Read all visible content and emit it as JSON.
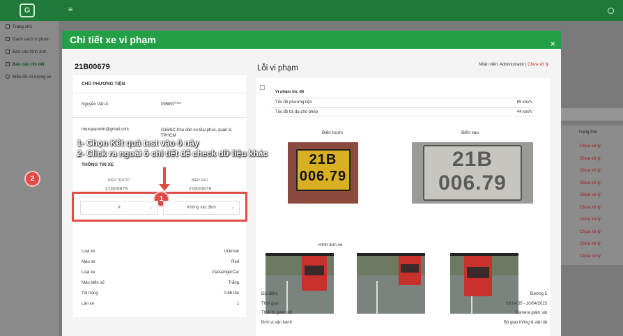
{
  "sidebar": {
    "items": [
      {
        "label": "Trang chủ"
      },
      {
        "label": "Danh sách vi phạm"
      },
      {
        "label": "Báo cáo hình ảnh"
      },
      {
        "label": "Báo cáo chi tiết"
      },
      {
        "label": "Biểu đồ số lượng xe"
      }
    ],
    "active_index": 3
  },
  "background": {
    "status_header": "Trạng thái",
    "status_values": [
      "Chưa xử lý",
      "Chưa xử lý",
      "Chưa xử lý",
      "Chưa xử lý",
      "Chưa xử lý",
      "Chưa xử lý",
      "Chưa xử lý",
      "Chưa xử lý",
      "Chưa xử lý",
      "Chưa xử lý"
    ]
  },
  "modal": {
    "title": "Chi tiết xe vi phạm",
    "plate": "21B00679",
    "owner_section": "CHỦ PHƯƠNG TIỆN",
    "owner_name": "Nguyễn Văn A",
    "owner_phone": "098897****",
    "owner_email": "moxquanmin@gmail.com",
    "owner_address": "G16/6C Khu dân cư Đại phúc, quận 8, TPHCM",
    "vehicle_section": "THÔNG TIN XE",
    "plate_before_label": "BIỂN TRƯỚC",
    "plate_after_label": "BIỂN SAU",
    "plate_before_value": "21B00679",
    "plate_after_value": "21B00679",
    "select_left_value": "X",
    "select_right_value": "Không xác định",
    "vehicle_rows": [
      {
        "label": "Loại xe",
        "value": "Unknow"
      },
      {
        "label": "Màu xe",
        "value": "Red"
      },
      {
        "label": "Loại xe",
        "value": "PassengerCar"
      },
      {
        "label": "Màu biển số",
        "value": "Trắng"
      },
      {
        "label": "Tải trọng",
        "value": "0.86 tấn"
      },
      {
        "label": "Làn xe",
        "value": "1"
      }
    ],
    "violation_heading": "Lỗi vi phạm",
    "staff_label": "Nhân viên: Administrator |",
    "staff_status": "Chưa xử lý",
    "violation_title": "Vi phạm tốc độ",
    "violation_rows": [
      {
        "label": "Tốc độ phương tiện",
        "value": "85 km/h"
      },
      {
        "label": "Tốc độ tối đa cho phép",
        "value": "44 km/h"
      }
    ],
    "front_plate_label": "Biển trước",
    "rear_plate_label": "Biển sau",
    "plate_image_line1": "21B",
    "plate_image_line2": "006.79",
    "vehicle_images_label": "Hình ảnh xe",
    "info_rows": [
      {
        "label": "Địa điểm",
        "value": "Đường 5"
      },
      {
        "label": "Thời gian",
        "value": "09:04:55 - 10/04/2023"
      },
      {
        "label": "Thiết bị giám sát",
        "value": "Camera giám sát"
      },
      {
        "label": "Đơn vị vận hành",
        "value": "Bộ giao thông & vận tải"
      }
    ]
  },
  "annotations": {
    "line1": "1- Chọn Kết quả test vào ô này",
    "line2": "2- Click ra ngoài ô chi tiết để check dữ liệu khác",
    "marker1": "1",
    "marker2": "2"
  },
  "colors": {
    "brand_green": "#23a045",
    "topbar_green": "#1f7a3a",
    "annotation_red": "#e04b45",
    "status_red": "#c0281f"
  }
}
